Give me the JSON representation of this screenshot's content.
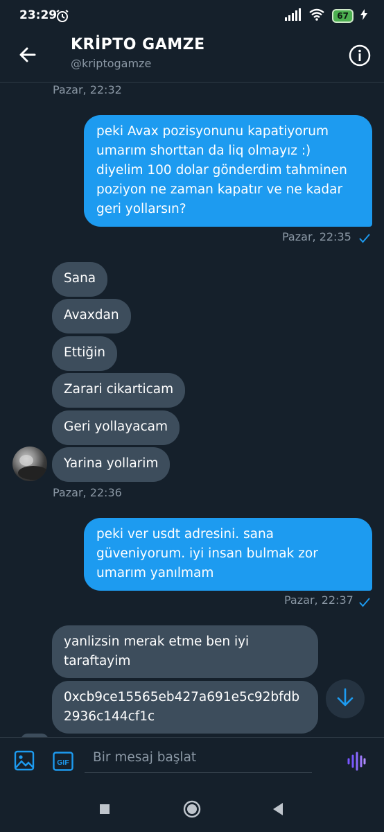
{
  "status_bar": {
    "time": "23:29",
    "battery": "67"
  },
  "header": {
    "title": "KRİPTO GAMZE",
    "handle": "@kriptogamze"
  },
  "messages": {
    "ts0": "Pazar, 22:32",
    "out1": "peki Avax pozisyonunu kapatiyorum umarım shorttan da liq olmayız :)  diyelim 100 dolar gönderdim tahminen poziyon ne zaman kapatır ve ne kadar geri yollarsın?",
    "ts1": "Pazar, 22:35",
    "in": [
      "Sana",
      "Avaxdan",
      "Ettiğin",
      "Zarari cikarticam",
      "Geri yollayacam",
      "Yarina yollarim"
    ],
    "ts2": "Pazar, 22:36",
    "out2": "peki ver usdt adresini. sana güveniyorum. iyi insan bulmak zor umarım yanılmam",
    "ts3": "Pazar, 22:37",
    "in2": "yanlizsin merak etme ben iyi taraftayim",
    "in3": "0xcb9ce15565eb427a691e5c92bfdb2936c144cf1c"
  },
  "composer": {
    "placeholder": "Bir mesaj başlat"
  },
  "colors": {
    "accent": "#1d9bf0",
    "background": "#15202b",
    "incoming": "#3d4d5c"
  }
}
